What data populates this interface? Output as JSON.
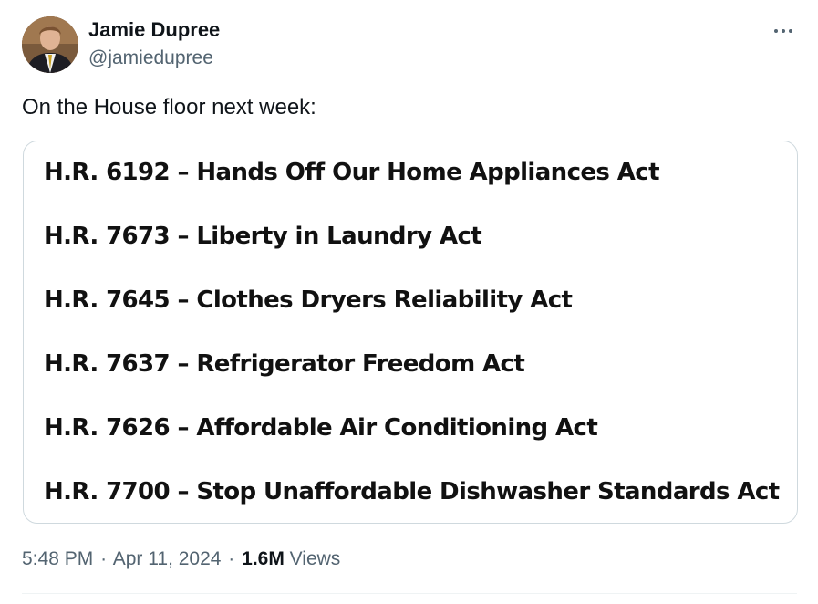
{
  "author": {
    "display_name": "Jamie Dupree",
    "handle": "@jamiedupree"
  },
  "menu": {
    "more_icon": "more-horizontal-icon"
  },
  "tweet": {
    "text": "On the House floor next week:"
  },
  "media": {
    "bills": [
      "H.R. 6192 – Hands Off Our Home Appliances Act",
      "H.R. 7673 – Liberty in Laundry Act",
      "H.R. 7645 – Clothes Dryers Reliability Act",
      "H.R. 7637 – Refrigerator Freedom Act",
      "H.R. 7626 – Affordable Air Conditioning Act",
      "H.R. 7700 – Stop Unaffordable Dishwasher Standards Act"
    ]
  },
  "meta": {
    "time": "5:48 PM",
    "separator": "·",
    "date": "Apr 11, 2024",
    "views_count": "1.6M",
    "views_label": "Views"
  },
  "colors": {
    "text_primary": "#0f1419",
    "text_secondary": "#536471",
    "border": "#cfd9de"
  }
}
